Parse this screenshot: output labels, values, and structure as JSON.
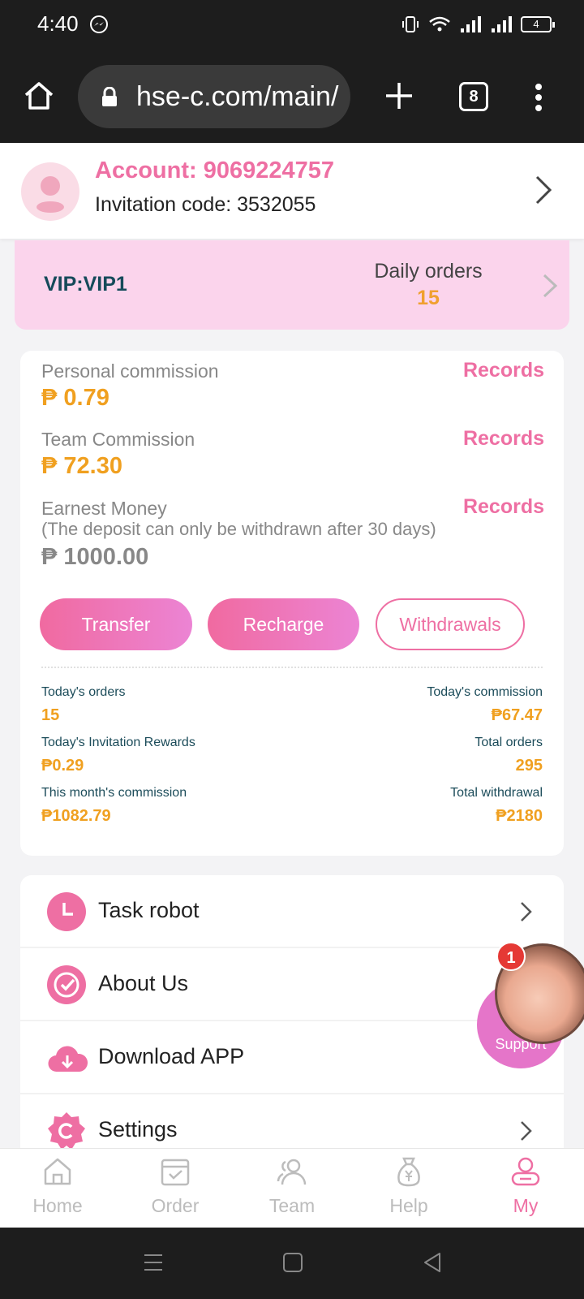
{
  "status_bar": {
    "time": "4:40",
    "battery": "4"
  },
  "browser": {
    "url": "hse-c.com/main/",
    "tab_count": "8"
  },
  "account": {
    "title": "Account: 9069224757",
    "invitation": "Invitation code: 3532055"
  },
  "vip": {
    "label": "VIP:VIP1",
    "daily_orders_label": "Daily orders",
    "daily_orders_value": "15"
  },
  "commission": {
    "personal_label": "Personal commission",
    "personal_value": "₱ 0.79",
    "team_label": "Team Commission",
    "team_value": "₱ 72.30",
    "earnest_label": "Earnest Money",
    "earnest_note": "(The deposit can only be withdrawn after 30 days)",
    "earnest_value": "₱ 1000.00",
    "records_label": "Records"
  },
  "buttons": {
    "transfer": "Transfer",
    "recharge": "Recharge",
    "withdrawals": "Withdrawals"
  },
  "stats": {
    "todays_orders_label": "Today's orders",
    "todays_orders_value": "15",
    "todays_commission_label": "Today's commission",
    "todays_commission_value": "₱67.47",
    "invitation_rewards_label": "Today's Invitation Rewards",
    "invitation_rewards_value": "₱0.29",
    "total_orders_label": "Total orders",
    "total_orders_value": "295",
    "month_commission_label": "This month's commission",
    "month_commission_value": "₱1082.79",
    "total_withdrawal_label": "Total withdrawal",
    "total_withdrawal_value": "₱2180"
  },
  "menu": {
    "task_robot": "Task robot",
    "about_us": "About Us",
    "download_app": "Download APP",
    "settings": "Settings"
  },
  "support": {
    "label": "Support",
    "badge": "1"
  },
  "nav": {
    "home": "Home",
    "order": "Order",
    "team": "Team",
    "help": "Help",
    "my": "My"
  },
  "colors": {
    "accent": "#ee6fa3",
    "gold": "#f0a020",
    "vip_bg": "#fbd4ec",
    "dark_teal": "#1c4c5a"
  }
}
